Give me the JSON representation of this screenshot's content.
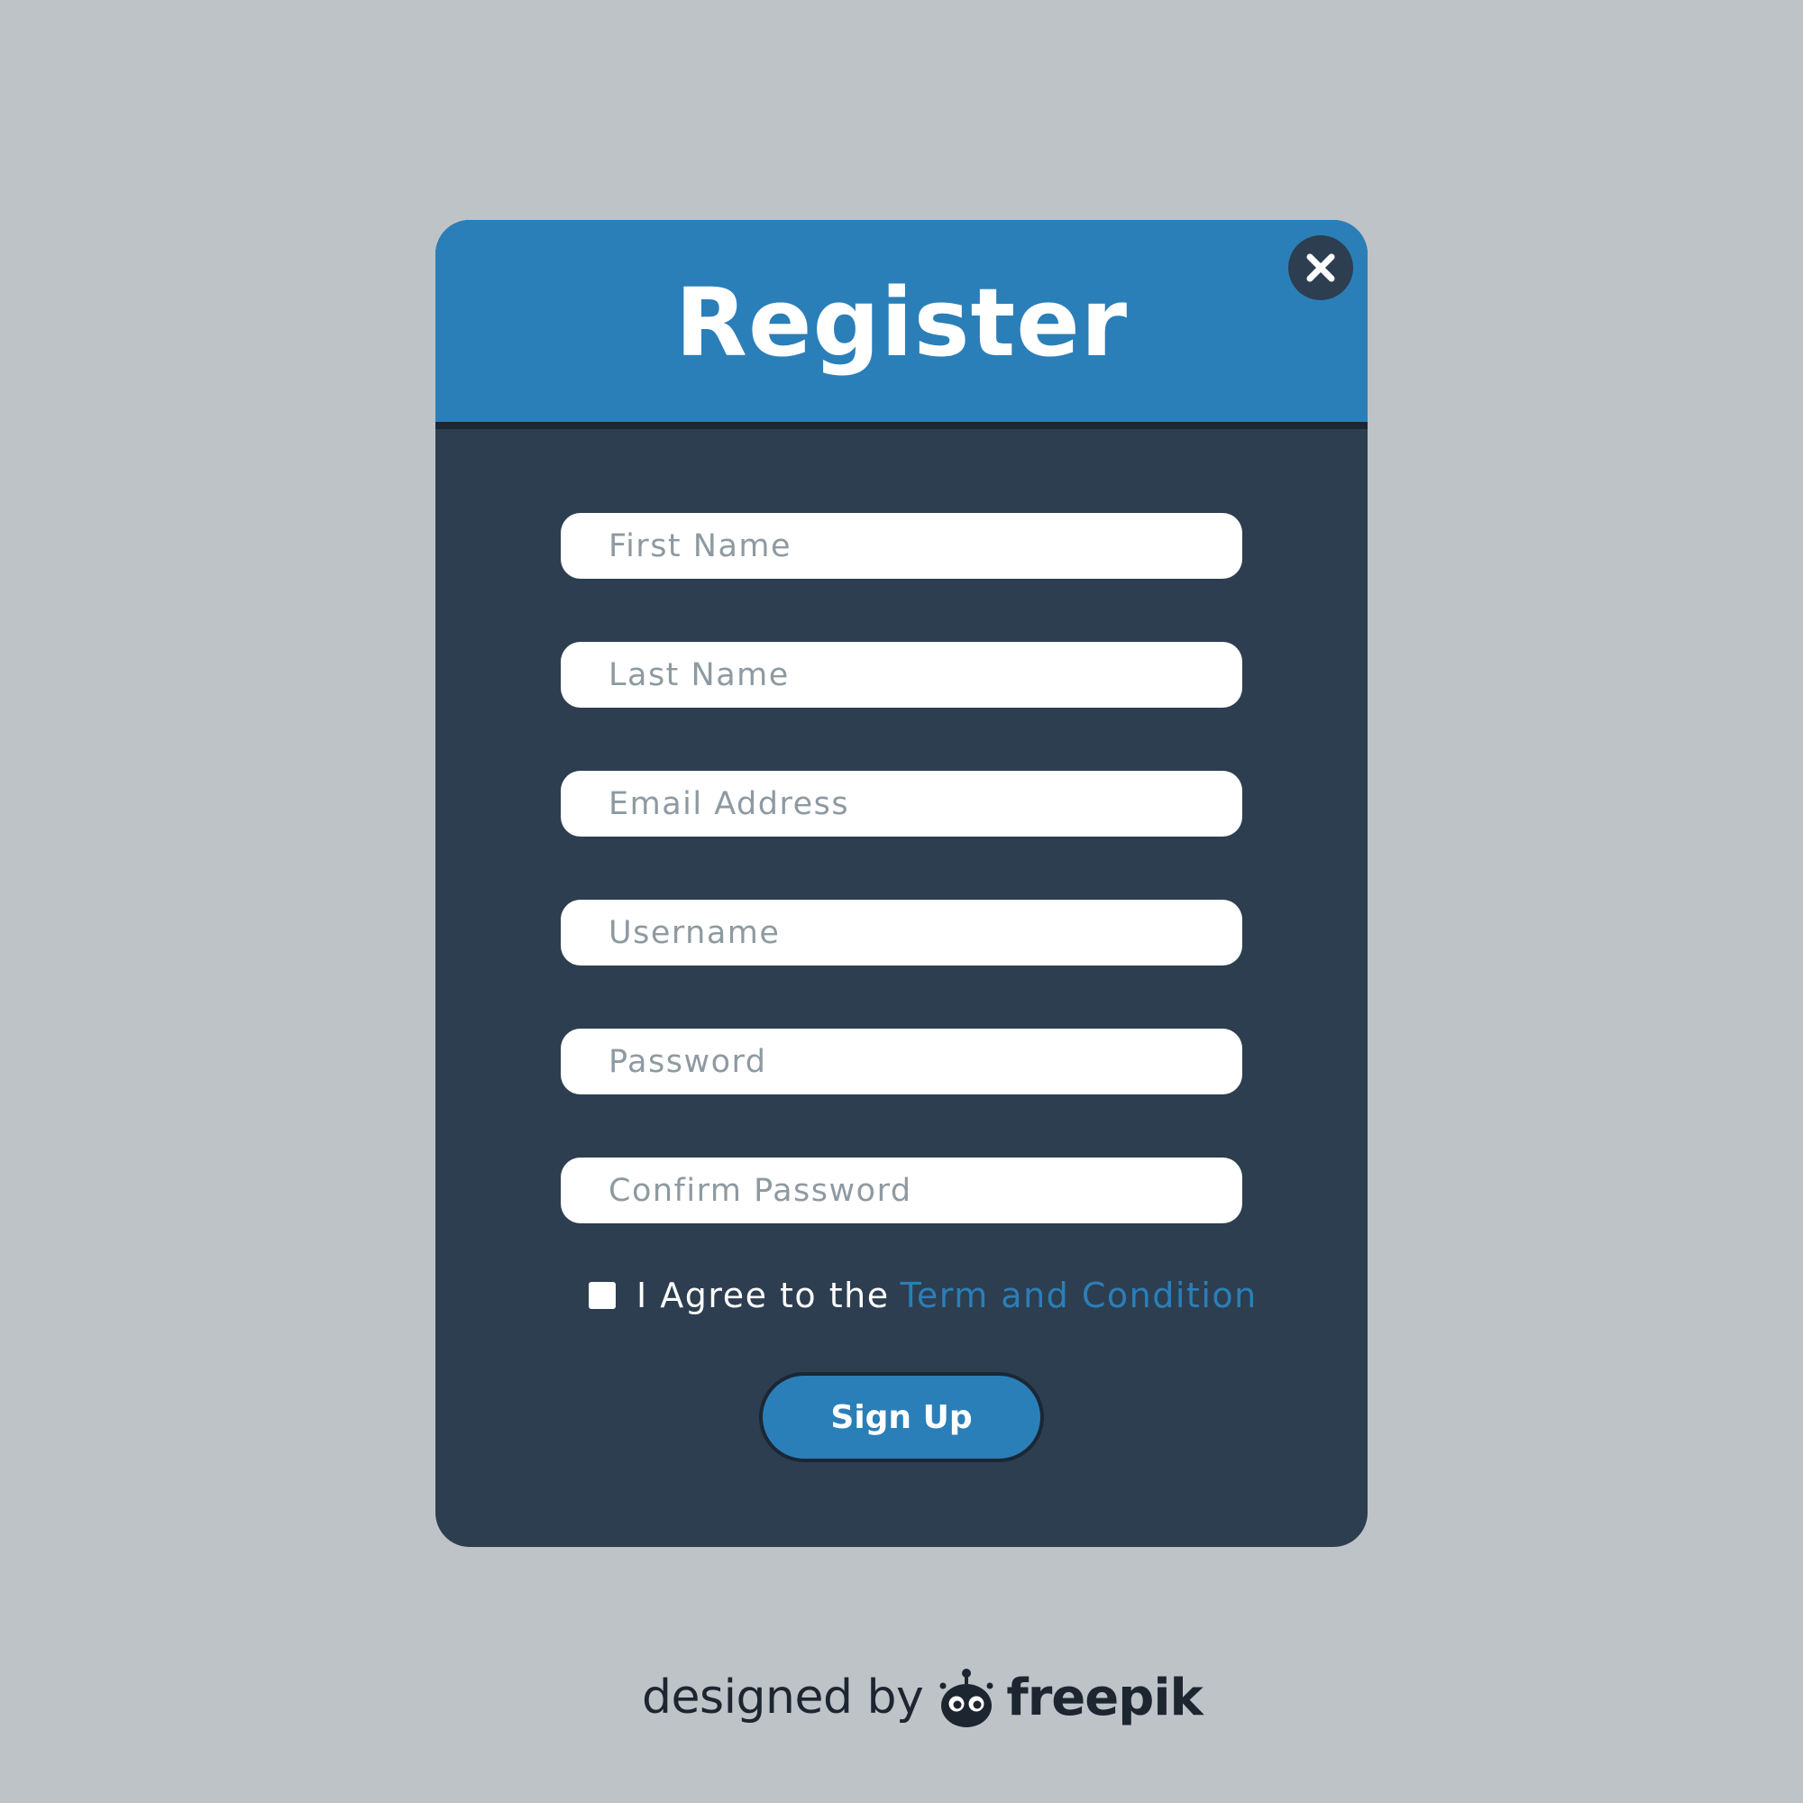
{
  "dialog": {
    "title": "Register",
    "close_icon": "close-icon"
  },
  "form": {
    "fields": [
      {
        "name": "first-name",
        "placeholder": "First Name",
        "value": ""
      },
      {
        "name": "last-name",
        "placeholder": "Last Name",
        "value": ""
      },
      {
        "name": "email-address",
        "placeholder": "Email Address",
        "value": ""
      },
      {
        "name": "username",
        "placeholder": "Username",
        "value": ""
      },
      {
        "name": "password",
        "placeholder": "Password",
        "value": ""
      },
      {
        "name": "confirm-password",
        "placeholder": "Confirm Password",
        "value": ""
      }
    ],
    "agree_checked": false,
    "agree_text": "I Agree to the",
    "agree_link": "Term and Condition",
    "submit_label": "Sign Up"
  },
  "credit": {
    "prefix": "designed by",
    "brand": "freepik",
    "logo_icon": "freepik-logo-icon"
  },
  "colors": {
    "background": "#bdc3c7",
    "dialog_body": "#2d3e50",
    "header_accent": "#2a7fb8",
    "link": "#2a7fb8",
    "placeholder": "#8e9aa1"
  }
}
